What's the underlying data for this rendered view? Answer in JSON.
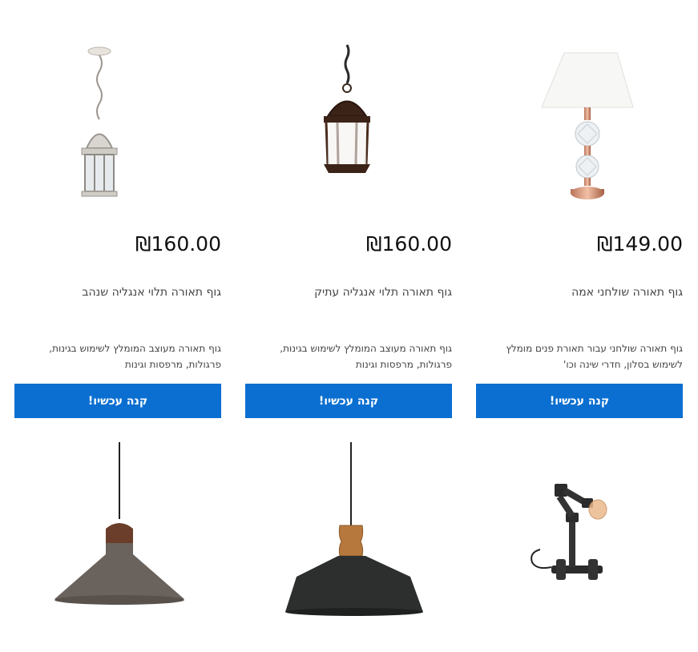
{
  "products": [
    {
      "price": "₪149.00",
      "title": "גוף תאורה שולחני אמה",
      "description": "גוף תאורה שולחני עבור תאורת פנים מומלץ לשימוש בסלון, חדרי שינה וכו'",
      "button": "קנה עכשיו!",
      "image_icon": "table-lamp-icon"
    },
    {
      "price": "₪160.00",
      "title": "גוף תאורה תלוי אנגליה עתיק",
      "description": "גוף תאורה מעוצב המומלץ לשימוש בגינות, פרגולות, מרפסות וגינות",
      "button": "קנה עכשיו!",
      "image_icon": "hanging-lantern-icon"
    },
    {
      "price": "₪160.00",
      "title": "גוף תאורה תלוי אנגליה שנהב",
      "description": "גוף תאורה מעוצב המומלץ לשימוש בגינות, פרגולות, מרפסות וגינות",
      "button": "קנה עכשיו!",
      "image_icon": "hanging-lantern-icon"
    }
  ],
  "second_row": [
    {
      "image_icon": "pipe-table-lamp-icon"
    },
    {
      "image_icon": "pendant-lamp-icon"
    },
    {
      "image_icon": "pendant-lamp-icon"
    }
  ],
  "colors": {
    "button_bg": "#0a6fd1",
    "button_text": "#ffffff"
  }
}
